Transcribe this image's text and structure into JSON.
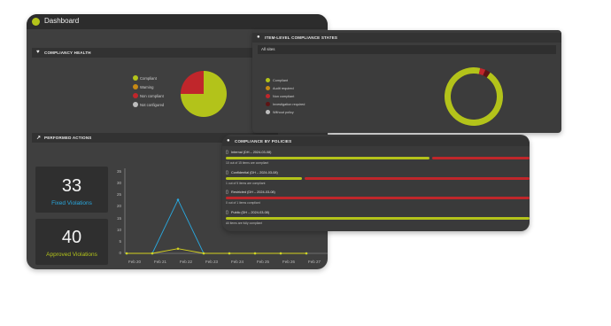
{
  "app": {
    "title": "Dashboard"
  },
  "colors": {
    "green": "#b3c31a",
    "orange": "#c78a14",
    "red": "#c0262b",
    "dark_red": "#5e1414",
    "grey": "#bdbdbd",
    "blue": "#29a9e0",
    "yellow": "#d5d21f"
  },
  "compliance_health": {
    "title": "COMPLIANCY HEALTH",
    "legend": [
      "Compliant",
      "Warning",
      "Non compliant",
      "Not configured"
    ],
    "chart_data": {
      "type": "pie",
      "labels": [
        "Compliant",
        "Non compliant"
      ],
      "values": [
        75,
        25
      ],
      "legend_position": "left"
    }
  },
  "item_level": {
    "title": "ITEM-LEVEL COMPLIANCE STATES",
    "filter": "All sites",
    "legend": [
      "Compliant",
      "Audit required",
      "Non compliant",
      "Investigation required",
      "Without policy"
    ],
    "chart_data": {
      "type": "pie",
      "labels": [
        "Compliant",
        "Non compliant",
        "Investigation required"
      ],
      "values": [
        94,
        3,
        3
      ]
    }
  },
  "performed_actions": {
    "title": "PERFORMED ACTIONS",
    "cards": [
      {
        "value": "33",
        "label": "Fixed Violations"
      },
      {
        "value": "40",
        "label": "Approved Violations"
      }
    ],
    "chart_data": {
      "type": "line",
      "categories": [
        "Feb 20",
        "Feb 21",
        "Feb 22",
        "Feb 23",
        "Feb 24",
        "Feb 25",
        "Feb 26",
        "Feb 27"
      ],
      "yticks": [
        "0",
        "5",
        "10",
        "15",
        "20",
        "25",
        "30",
        "35"
      ],
      "ylim": [
        0,
        35
      ],
      "series": [
        {
          "values": [
            0,
            0,
            23,
            0,
            0,
            0,
            0,
            0
          ]
        },
        {
          "values": [
            0,
            0,
            2,
            0,
            0,
            0,
            0,
            0
          ]
        }
      ]
    }
  },
  "compliance_by_policies": {
    "title": "COMPLIANCE BY POLICIES",
    "rows": [
      {
        "name": "Internal (DH – 2024-03-08)",
        "sub": "10 out of 15 items are compliant",
        "compliant": 0.67
      },
      {
        "name": "Confidential (DH – 2024-03-08)",
        "sub": "1 out of 5 items are compliant",
        "compliant": 0.25
      },
      {
        "name": "Restricted (DH – 2024-03-08)",
        "sub": "0 out of 1 items compliant",
        "compliant": 0.0
      },
      {
        "name": "Public (DH – 2024-03-08)",
        "sub": "All items are fully compliant",
        "compliant": 1.0
      }
    ]
  }
}
